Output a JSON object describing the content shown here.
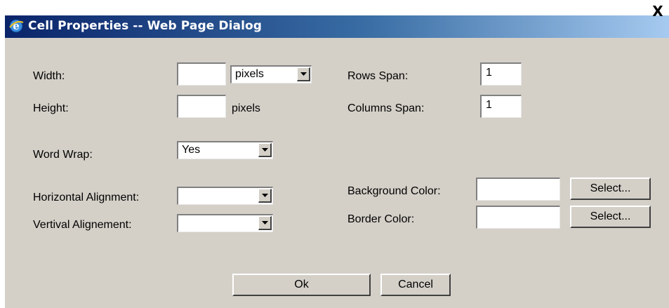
{
  "window": {
    "title": "Cell Properties -- Web Page Dialog",
    "close_label": "X",
    "icon": "ie-icon"
  },
  "form": {
    "width_label": "Width:",
    "width_value": "",
    "width_unit": "pixels",
    "height_label": "Height:",
    "height_value": "",
    "height_unit": "pixels",
    "rows_span_label": "Rows Span:",
    "rows_span_value": "1",
    "columns_span_label": "Columns Span:",
    "columns_span_value": "1",
    "word_wrap_label": "Word Wrap:",
    "word_wrap_value": "Yes",
    "horizontal_alignment_label": "Horizontal Alignment:",
    "horizontal_alignment_value": "",
    "vertical_alignment_label": "Vertival Alignement:",
    "vertical_alignment_value": "",
    "background_color_label": "Background Color:",
    "background_color_value": "",
    "border_color_label": "Border Color:",
    "border_color_value": "",
    "select_label": "Select..."
  },
  "buttons": {
    "ok": "Ok",
    "cancel": "Cancel"
  },
  "colors": {
    "dialog_bg": "#d4d0c8",
    "titlebar_start": "#0a246a",
    "titlebar_end": "#a6caf0"
  }
}
